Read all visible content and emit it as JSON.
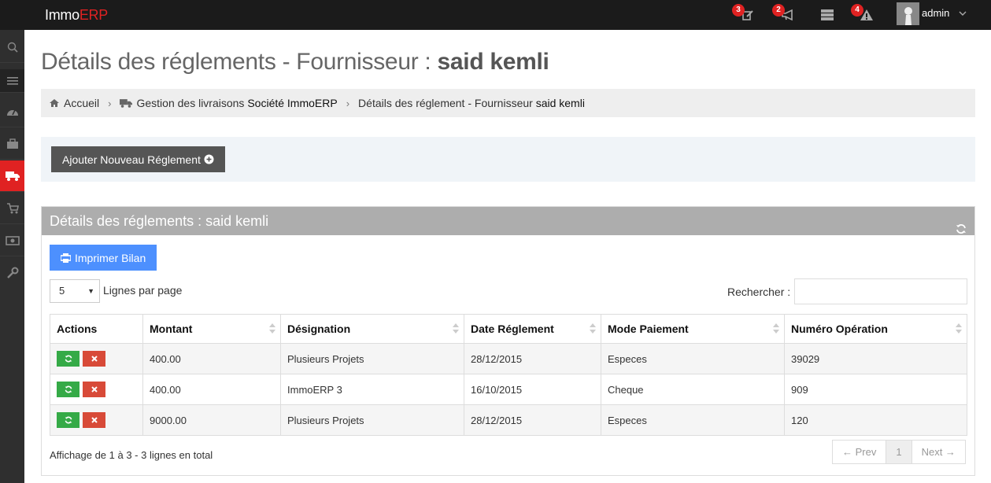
{
  "app": {
    "logo_main": "Immo",
    "logo_accent": "ERP"
  },
  "topbar": {
    "notifications": [
      {
        "icon": "edit-icon",
        "badge": "3"
      },
      {
        "icon": "bullhorn-icon",
        "badge": "2"
      },
      {
        "icon": "server-icon",
        "badge": ""
      },
      {
        "icon": "warning-icon",
        "badge": "4"
      }
    ],
    "user": "admin"
  },
  "sidebar": {
    "items": [
      {
        "icon": "search-icon",
        "active": false
      },
      {
        "icon": "menu-toggle-icon",
        "active": false
      },
      {
        "icon": "dashboard-icon",
        "active": false
      },
      {
        "icon": "briefcase-icon",
        "active": false
      },
      {
        "icon": "truck-icon",
        "active": true
      },
      {
        "icon": "cart-icon",
        "active": false
      },
      {
        "icon": "money-icon",
        "active": false
      },
      {
        "icon": "wrench-icon",
        "active": false
      }
    ]
  },
  "page": {
    "title_prefix": "Détails des réglements - Fournisseur : ",
    "title_name": "said kemli"
  },
  "breadcrumb": {
    "home": "Accueil",
    "livraisons_prefix": "Gestion des livraisons ",
    "livraisons_company": "Société ImmoERP",
    "current_prefix": "Détails des réglement - Fournisseur ",
    "current_name": "said kemli"
  },
  "actions": {
    "add_label": "Ajouter Nouveau Réglement"
  },
  "portlet": {
    "title": "Détails des réglements : said kemli",
    "print_label": "Imprimer Bilan",
    "page_size": "5",
    "page_size_label": "Lignes par page",
    "search_label": "Rechercher :",
    "search_value": ""
  },
  "table": {
    "columns": [
      "Actions",
      "Montant",
      "Désignation",
      "Date Réglement",
      "Mode Paiement",
      "Numéro Opération"
    ],
    "rows": [
      {
        "montant": "400.00",
        "designation": "Plusieurs Projets",
        "date": "28/12/2015",
        "mode": "Especes",
        "numero": "39029"
      },
      {
        "montant": "400.00",
        "designation": "ImmoERP 3",
        "date": "16/10/2015",
        "mode": "Cheque",
        "numero": "909"
      },
      {
        "montant": "9000.00",
        "designation": "Plusieurs Projets",
        "date": "28/12/2015",
        "mode": "Especes",
        "numero": "120"
      }
    ]
  },
  "footer": {
    "info": "Affichage de 1 à 3 - 3 lignes en total",
    "prev": "← Prev",
    "page": "1",
    "next": "Next →"
  },
  "colors": {
    "accent": "#e02222",
    "print_button": "#4d90fe",
    "update_button": "#35aa47",
    "delete_button": "#d84a38"
  }
}
